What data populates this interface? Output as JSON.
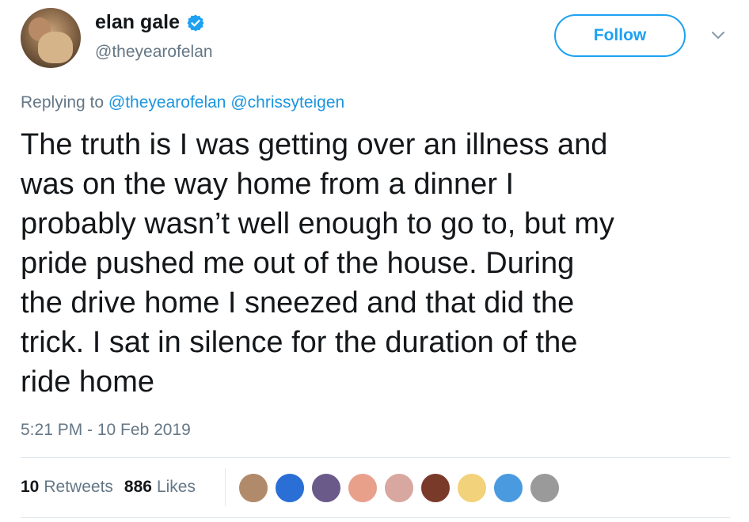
{
  "user": {
    "display_name": "elan gale",
    "handle": "@theyearofelan",
    "verified": true
  },
  "follow_label": "Follow",
  "reply": {
    "prefix": "Replying to",
    "mentions": [
      "@theyearofelan",
      "@chrissyteigen"
    ]
  },
  "tweet": {
    "text": "The truth is I was getting over an illness and\nwas on the way home from a dinner I\nprobably wasn’t well enough to go to, but my\npride pushed me out of the house. During\nthe drive home I sneezed and that did the\ntrick. I sat in silence for the duration of the\nride home",
    "timestamp": "5:21 PM - 10 Feb 2019"
  },
  "stats": {
    "retweets_count": "10",
    "retweets_label": "Retweets",
    "likes_count": "886",
    "likes_label": "Likes"
  },
  "likers": [
    {
      "color": "#b08a6a"
    },
    {
      "color": "#2a6fd6"
    },
    {
      "color": "#6a5a8a"
    },
    {
      "color": "#e8a08a"
    },
    {
      "color": "#d8a8a0"
    },
    {
      "color": "#7a3a2a"
    },
    {
      "color": "#f2d27a"
    },
    {
      "color": "#4a9ae0"
    },
    {
      "color": "#9a9a9a"
    }
  ],
  "colors": {
    "accent": "#1da1f2",
    "text": "#14171a",
    "muted": "#657786"
  }
}
